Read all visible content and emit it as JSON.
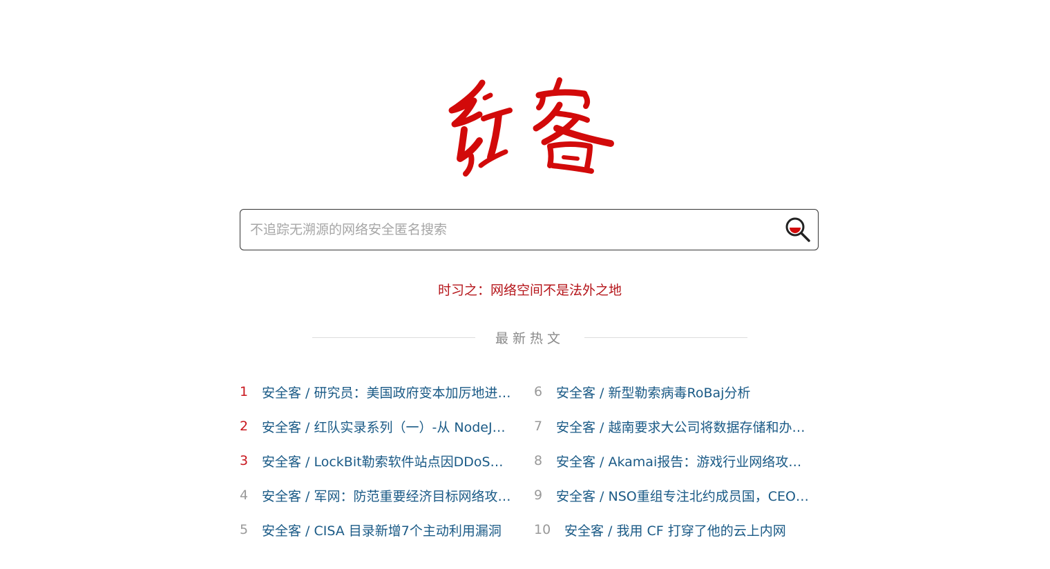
{
  "logo": {
    "text": "红客",
    "color": "#d20a0a"
  },
  "search": {
    "placeholder": "不追踪无溯源的网络安全匿名搜索",
    "value": "",
    "icon": "magnifier-icon"
  },
  "slogan": "时习之：网络空间不是法外之地",
  "hot": {
    "title": "最新热文",
    "left_items": [
      {
        "rank": "1",
        "title": "安全客 / 研究员：美国政府变本加厉地进…"
      },
      {
        "rank": "2",
        "title": "安全客 / 红队实录系列（一）-从 NodeJ…"
      },
      {
        "rank": "3",
        "title": "安全客 / LockBit勒索软件站点因DDoS…"
      },
      {
        "rank": "4",
        "title": "安全客 / 军网：防范重要经济目标网络攻…"
      },
      {
        "rank": "5",
        "title": "安全客 / CISA 目录新增7个主动利用漏洞"
      }
    ],
    "right_items": [
      {
        "rank": "6",
        "title": "安全客 / 新型勒索病毒RoBaj分析"
      },
      {
        "rank": "7",
        "title": "安全客 / 越南要求大公司将数据存储和办…"
      },
      {
        "rank": "8",
        "title": "安全客 / Akamai报告：游戏行业网络攻…"
      },
      {
        "rank": "9",
        "title": "安全客 / NSO重组专注北约成员国，CEO…"
      },
      {
        "rank": "10",
        "title": "安全客 / 我用 CF 打穿了他的云上内网"
      }
    ]
  },
  "colors": {
    "brand_red": "#c8161d",
    "link_blue": "#1a5a86",
    "muted_gray": "#999999"
  }
}
